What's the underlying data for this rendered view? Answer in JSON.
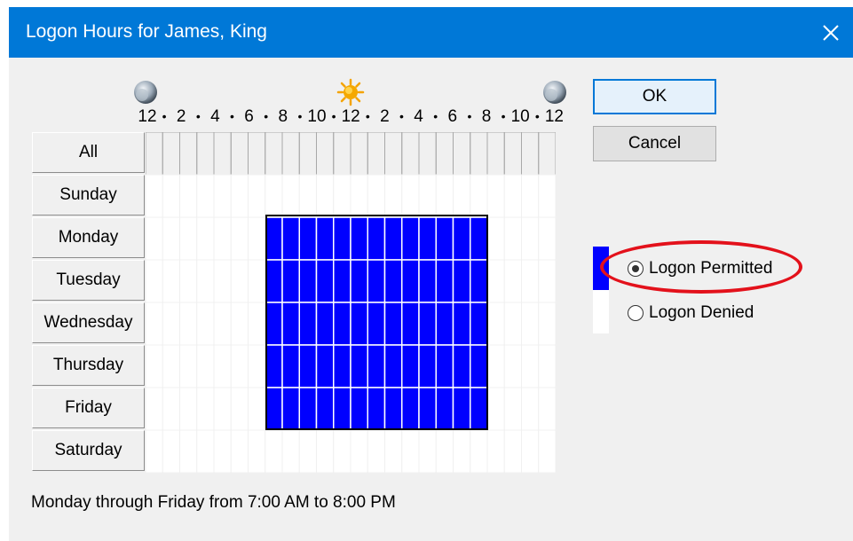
{
  "window": {
    "title": "Logon Hours for James, King"
  },
  "hour_header": [
    {
      "text": "12",
      "kind": "label"
    },
    {
      "text": "•",
      "kind": "dot"
    },
    {
      "text": "2",
      "kind": "label"
    },
    {
      "text": "•",
      "kind": "dot"
    },
    {
      "text": "4",
      "kind": "label"
    },
    {
      "text": "•",
      "kind": "dot"
    },
    {
      "text": "6",
      "kind": "label"
    },
    {
      "text": "•",
      "kind": "dot"
    },
    {
      "text": "8",
      "kind": "label"
    },
    {
      "text": "•",
      "kind": "dot"
    },
    {
      "text": "10",
      "kind": "label"
    },
    {
      "text": "•",
      "kind": "dot"
    },
    {
      "text": "12",
      "kind": "label"
    },
    {
      "text": "•",
      "kind": "dot"
    },
    {
      "text": "2",
      "kind": "label"
    },
    {
      "text": "•",
      "kind": "dot"
    },
    {
      "text": "4",
      "kind": "label"
    },
    {
      "text": "•",
      "kind": "dot"
    },
    {
      "text": "6",
      "kind": "label"
    },
    {
      "text": "•",
      "kind": "dot"
    },
    {
      "text": "8",
      "kind": "label"
    },
    {
      "text": "•",
      "kind": "dot"
    },
    {
      "text": "10",
      "kind": "label"
    },
    {
      "text": "•",
      "kind": "dot"
    },
    {
      "text": "12",
      "kind": "label"
    }
  ],
  "header_icons": [
    "moon-icon",
    "sun-icon",
    "moon-icon"
  ],
  "rows": {
    "all": "All",
    "days": [
      "Sunday",
      "Monday",
      "Tuesday",
      "Wednesday",
      "Thursday",
      "Friday",
      "Saturday"
    ]
  },
  "schedule": {
    "hours_per_day": 24,
    "permitted_days": [
      "Monday",
      "Tuesday",
      "Wednesday",
      "Thursday",
      "Friday"
    ],
    "permitted_start_hour": 7,
    "permitted_end_hour": 20
  },
  "colors": {
    "permitted": "#0000ff",
    "denied": "#ffffff",
    "titlebar": "#0078d7",
    "highlight_ellipse": "#e3111b"
  },
  "buttons": {
    "ok": "OK",
    "cancel": "Cancel"
  },
  "options": {
    "permitted": "Logon Permitted",
    "denied": "Logon Denied",
    "selected": "permitted"
  },
  "summary": "Monday through Friday from 7:00 AM to 8:00 PM"
}
